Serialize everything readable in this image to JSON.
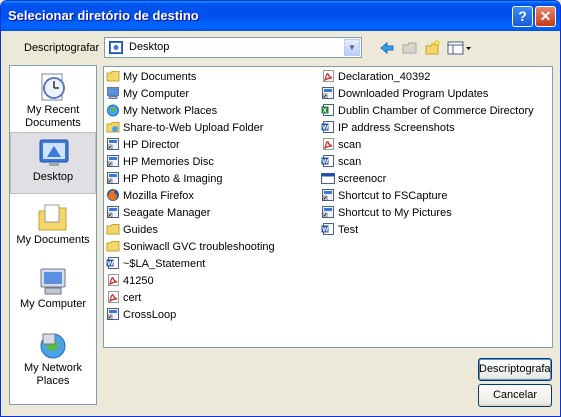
{
  "window": {
    "title": "Selecionar diretório de destino"
  },
  "toolbar": {
    "look_in_label": "Descriptografar",
    "location": "Desktop"
  },
  "places": [
    {
      "label": "My Recent Documents",
      "icon": "recent-documents-icon"
    },
    {
      "label": "Desktop",
      "icon": "desktop-icon",
      "selected": true
    },
    {
      "label": "My Documents",
      "icon": "my-documents-icon"
    },
    {
      "label": "My Computer",
      "icon": "my-computer-icon"
    },
    {
      "label": "My Network Places",
      "icon": "network-places-icon"
    }
  ],
  "files": {
    "col1": [
      {
        "name": "My Documents",
        "icon": "folder"
      },
      {
        "name": "My Computer",
        "icon": "computer"
      },
      {
        "name": "My Network Places",
        "icon": "network"
      },
      {
        "name": "Share-to-Web Upload Folder",
        "icon": "share"
      },
      {
        "name": "HP Director",
        "icon": "shortcut"
      },
      {
        "name": "HP Memories Disc",
        "icon": "shortcut"
      },
      {
        "name": "HP Photo & Imaging",
        "icon": "shortcut"
      },
      {
        "name": "Mozilla Firefox",
        "icon": "firefox"
      },
      {
        "name": "Seagate Manager",
        "icon": "shortcut"
      },
      {
        "name": "Guides",
        "icon": "folder"
      },
      {
        "name": "Soniwacll GVC troubleshooting",
        "icon": "folder"
      },
      {
        "name": "~$LA_Statement",
        "icon": "word"
      },
      {
        "name": "41250",
        "icon": "pdf"
      },
      {
        "name": "cert",
        "icon": "pdf"
      },
      {
        "name": "CrossLoop",
        "icon": "shortcut"
      }
    ],
    "col2": [
      {
        "name": "Declaration_40392",
        "icon": "pdf"
      },
      {
        "name": "Downloaded Program Updates",
        "icon": "shortcut"
      },
      {
        "name": "Dublin Chamber of Commerce Directory",
        "icon": "excel"
      },
      {
        "name": "IP address Screenshots",
        "icon": "word"
      },
      {
        "name": "scan",
        "icon": "pdf"
      },
      {
        "name": "scan",
        "icon": "word"
      },
      {
        "name": "screenocr",
        "icon": "window"
      },
      {
        "name": "Shortcut to FSCapture",
        "icon": "shortcut"
      },
      {
        "name": "Shortcut to My Pictures",
        "icon": "shortcut"
      },
      {
        "name": "Test",
        "icon": "word"
      }
    ]
  },
  "buttons": {
    "ok_label": "Descriptografar",
    "cancel_label": "Cancelar"
  },
  "colors": {
    "title_bar": "#0054e3",
    "dialog_bg": "#ece9d8",
    "border": "#7f9db9"
  }
}
